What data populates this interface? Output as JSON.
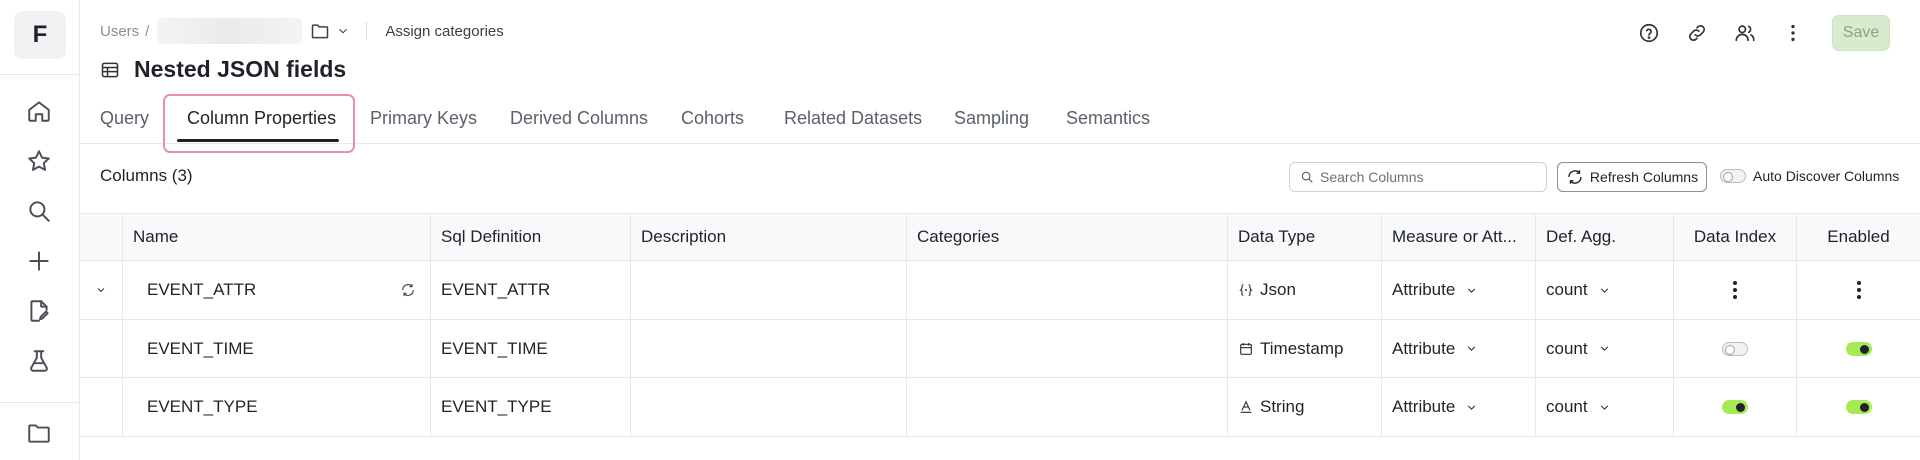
{
  "app": {
    "logo": "F"
  },
  "sidebar": {
    "icons": [
      "home-icon",
      "star-icon",
      "search-icon",
      "plus-icon",
      "edit-file-icon",
      "lab-icon",
      "folder-icon"
    ]
  },
  "breadcrumb": {
    "root": "Users",
    "separator": "/",
    "action": "Assign categories"
  },
  "header": {
    "title": "Nested JSON fields",
    "save_label": "Save",
    "save_color": "#d7ecce"
  },
  "tabs": [
    {
      "label": "Query"
    },
    {
      "label": "Column Properties",
      "active": true
    },
    {
      "label": "Primary Keys"
    },
    {
      "label": "Derived Columns"
    },
    {
      "label": "Cohorts"
    },
    {
      "label": "Related Datasets"
    },
    {
      "label": "Sampling"
    },
    {
      "label": "Semantics"
    }
  ],
  "columns_panel": {
    "heading": "Columns (3)",
    "search_placeholder": "Search Columns",
    "refresh_label": "Refresh Columns",
    "auto_discover_label": "Auto Discover Columns",
    "auto_discover_on": false
  },
  "table": {
    "headers": [
      "Name",
      "Sql Definition",
      "Description",
      "Categories",
      "Data Type",
      "Measure or Att...",
      "Def. Agg.",
      "Data Index",
      "Enabled"
    ],
    "rows": [
      {
        "name": "EVENT_ATTR",
        "sql": "EVENT_ATTR",
        "description": "",
        "categories": "",
        "data_type": "Json",
        "type_icon": "json-icon",
        "measure": "Attribute",
        "agg": "count",
        "data_index": "menu",
        "enabled": "menu",
        "expandable": true,
        "synced_icon": true
      },
      {
        "name": "EVENT_TIME",
        "sql": "EVENT_TIME",
        "description": "",
        "categories": "",
        "data_type": "Timestamp",
        "type_icon": "calendar-icon",
        "measure": "Attribute",
        "agg": "count",
        "data_index": "off",
        "enabled": "on"
      },
      {
        "name": "EVENT_TYPE",
        "sql": "EVENT_TYPE",
        "description": "",
        "categories": "",
        "data_type": "String",
        "type_icon": "string-icon",
        "measure": "Attribute",
        "agg": "count",
        "data_index": "on",
        "enabled": "on"
      }
    ]
  },
  "colors": {
    "accent_highlight": "#e690ad",
    "toggle_on": "#a6eb56"
  }
}
